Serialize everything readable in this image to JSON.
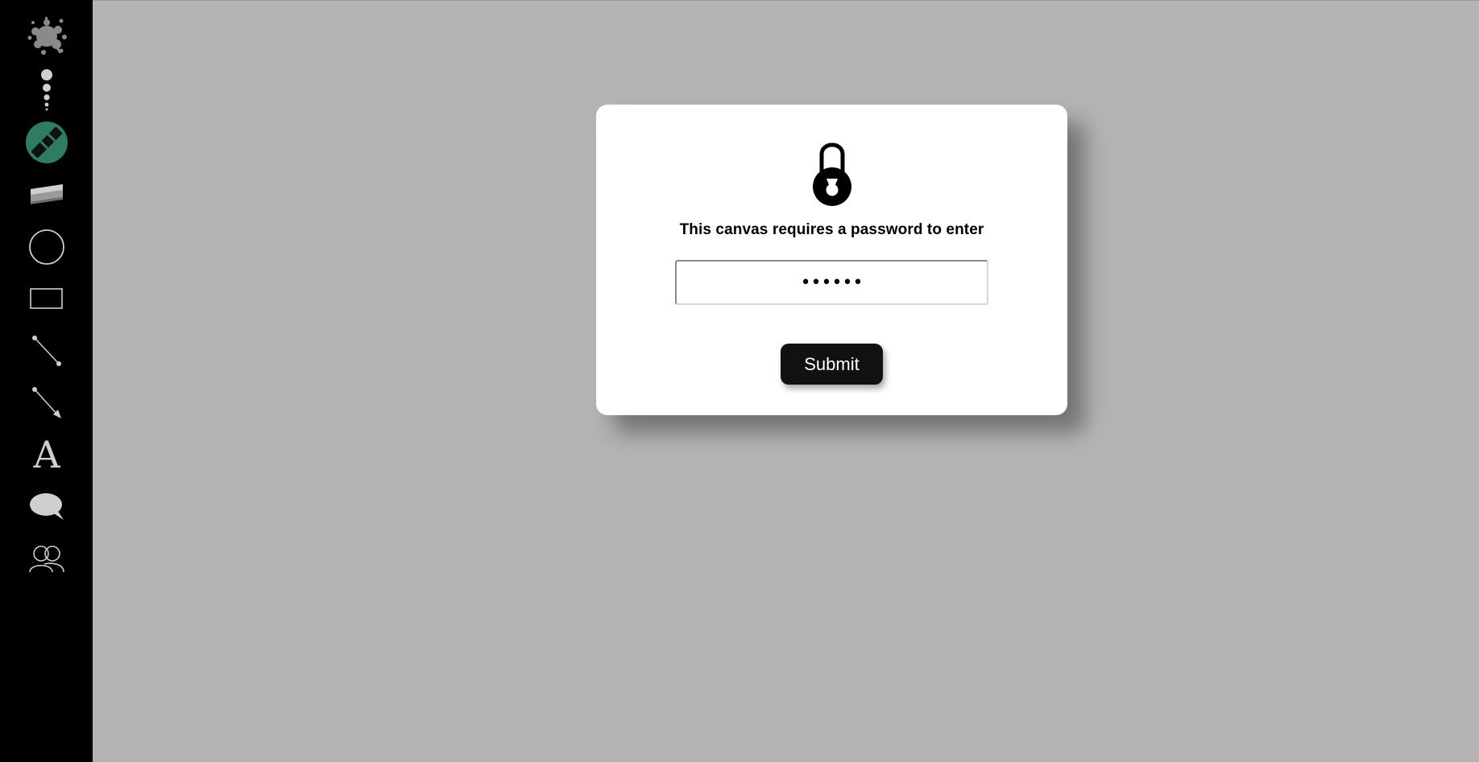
{
  "toolbar": {
    "tools": [
      {
        "name": "color-splat-icon"
      },
      {
        "name": "brush-size-icon"
      },
      {
        "name": "marker-pen-icon",
        "active": true,
        "active_color": "#2e7d60"
      },
      {
        "name": "eraser-icon"
      },
      {
        "name": "circle-icon"
      },
      {
        "name": "rectangle-icon"
      },
      {
        "name": "line-icon"
      },
      {
        "name": "arrow-icon"
      },
      {
        "name": "text-icon",
        "glyph": "A"
      },
      {
        "name": "comment-bubble-icon"
      },
      {
        "name": "users-icon"
      }
    ]
  },
  "dialog": {
    "icon": "lock-icon",
    "prompt": "This canvas requires a password to enter",
    "password_value": "secret",
    "submit_label": "Submit"
  },
  "colors": {
    "canvas_background": "#b3b3b3",
    "toolbar_background": "#000000",
    "button_background": "#111111"
  }
}
